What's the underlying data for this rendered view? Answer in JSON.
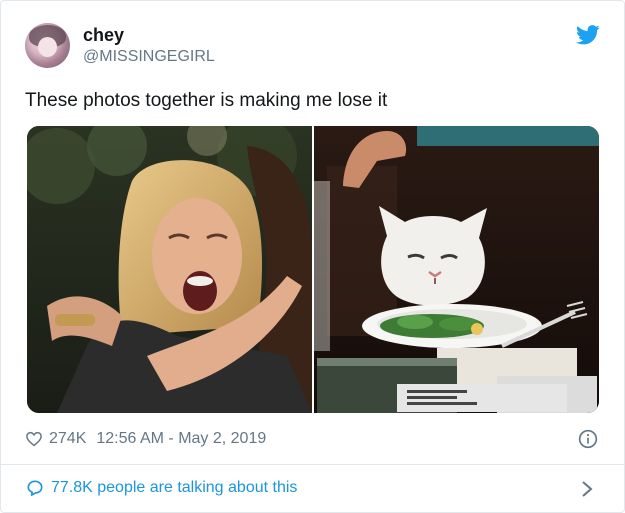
{
  "author": {
    "name": "chey",
    "handle": "@MISSINGEGIRL"
  },
  "tweet": {
    "text": "These photos together is making me lose it"
  },
  "meta": {
    "likes": "274K",
    "timestamp": "12:56 AM - May 2, 2019"
  },
  "footer": {
    "conversation": "77.8K people are talking about this"
  },
  "icons": {
    "brand": "twitter-bird-icon",
    "like": "heart-icon",
    "info": "info-icon",
    "reply": "speech-bubble-icon",
    "more": "chevron-right-icon"
  },
  "colors": {
    "brand": "#1da1f2",
    "link": "#1b95e0",
    "muted": "#657786",
    "text": "#14171a",
    "border": "#e1e8ed"
  }
}
